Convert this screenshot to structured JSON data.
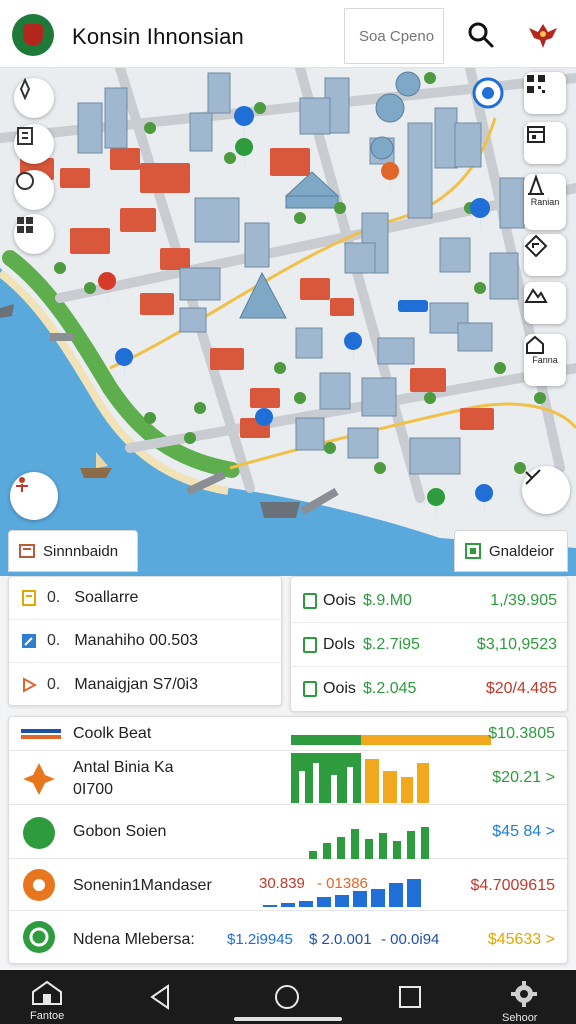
{
  "header": {
    "title": "Konsin Ihnonsian",
    "search_placeholder": "Soa Cpeno"
  },
  "map": {
    "labels": {
      "right_1": "Ranian",
      "right_2": "Fanna"
    },
    "pin_colors": [
      "#1f6fd6",
      "#2e9b3e",
      "#e0662a",
      "#d63b2a"
    ]
  },
  "tabs": {
    "left_label": "Sinnnbaidn",
    "right_label": "Gnaldeior"
  },
  "left_panel": {
    "rows": [
      {
        "num": "0.",
        "label": "Soallarre",
        "icon": "document-icon"
      },
      {
        "num": "0.",
        "label": "Manahiho 00.503",
        "icon": "edit-icon"
      },
      {
        "num": "0.",
        "label": "Manaigjan S7/0i3",
        "icon": "play-icon"
      }
    ]
  },
  "right_panel": {
    "rows": [
      {
        "label": "Oois",
        "value": "$.9.M0",
        "right": "1,/39.905",
        "right_color": "#2e9b3e"
      },
      {
        "label": "Dols",
        "value": "$.2.7i95",
        "right": "$3,10,9523",
        "right_color": "#2e9b3e"
      },
      {
        "label": "Oois",
        "value": "$.2.045",
        "right": "$20/4.485",
        "right_color": "#c0392b"
      }
    ]
  },
  "list": {
    "items": [
      {
        "name": "Coolk Beat",
        "value": "$10.3805",
        "value_color": "#2e9b3e"
      },
      {
        "name": "Antal Binia Ka",
        "sub": "0I700",
        "value": "$20.21 >",
        "value_color": "#2e9b3e"
      },
      {
        "name": "Gobon Soien",
        "value": "$45 84 >",
        "value_color": "#1f7ed6"
      },
      {
        "name": "Sonenin1Mandaser",
        "mid_a": "30.839",
        "mid_b": "- 01386",
        "value": "$4.7009615",
        "value_color": "#c0392b"
      },
      {
        "name": "Ndena Mlebersa:",
        "mid_a": "$1.2i9945",
        "mid_b": "$ 2.0.001",
        "mid_c": "- 00.0i94",
        "value": "$45633 >",
        "value_color": "#e0a800"
      }
    ]
  },
  "nav": {
    "left_label": "Fantoe",
    "right_label": "Sehoor"
  }
}
